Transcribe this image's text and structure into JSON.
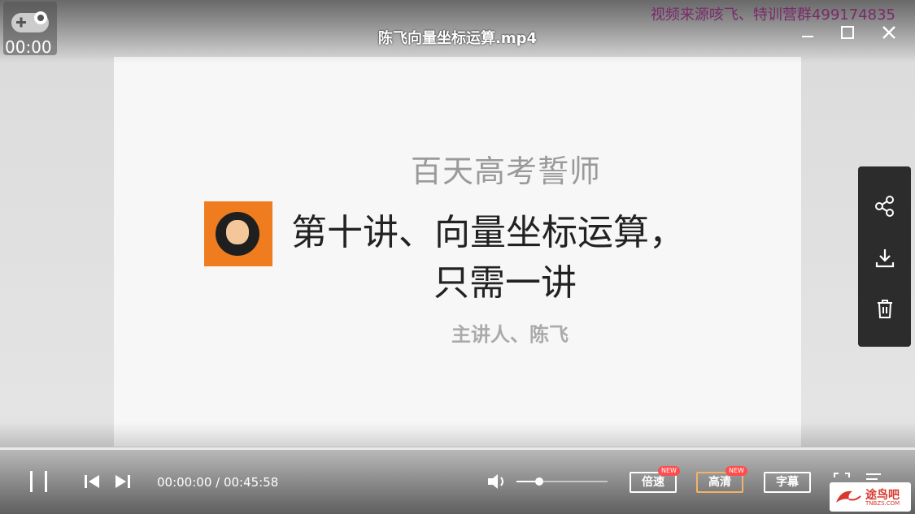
{
  "window": {
    "title": "陈飞向量坐标运算.mp4",
    "watermark": "视频来源咳飞、特训营群499174835",
    "mini_time": "00:00"
  },
  "slide": {
    "heading": "百天高考誓师",
    "title_line1": "第十讲、向量坐标运算，",
    "title_line2": "只需一讲",
    "author": "主讲人、陈飞"
  },
  "player": {
    "time_display": "00:00:00 / 00:45:58",
    "progress_fraction": 0,
    "volume_fraction": 0.25,
    "speed_label": "倍速",
    "quality_label": "高清",
    "subtitle_label": "字幕",
    "new_badge": "NEW"
  },
  "site_logo": {
    "text": "途鸟吧",
    "sub": "TNBZS.COM"
  }
}
